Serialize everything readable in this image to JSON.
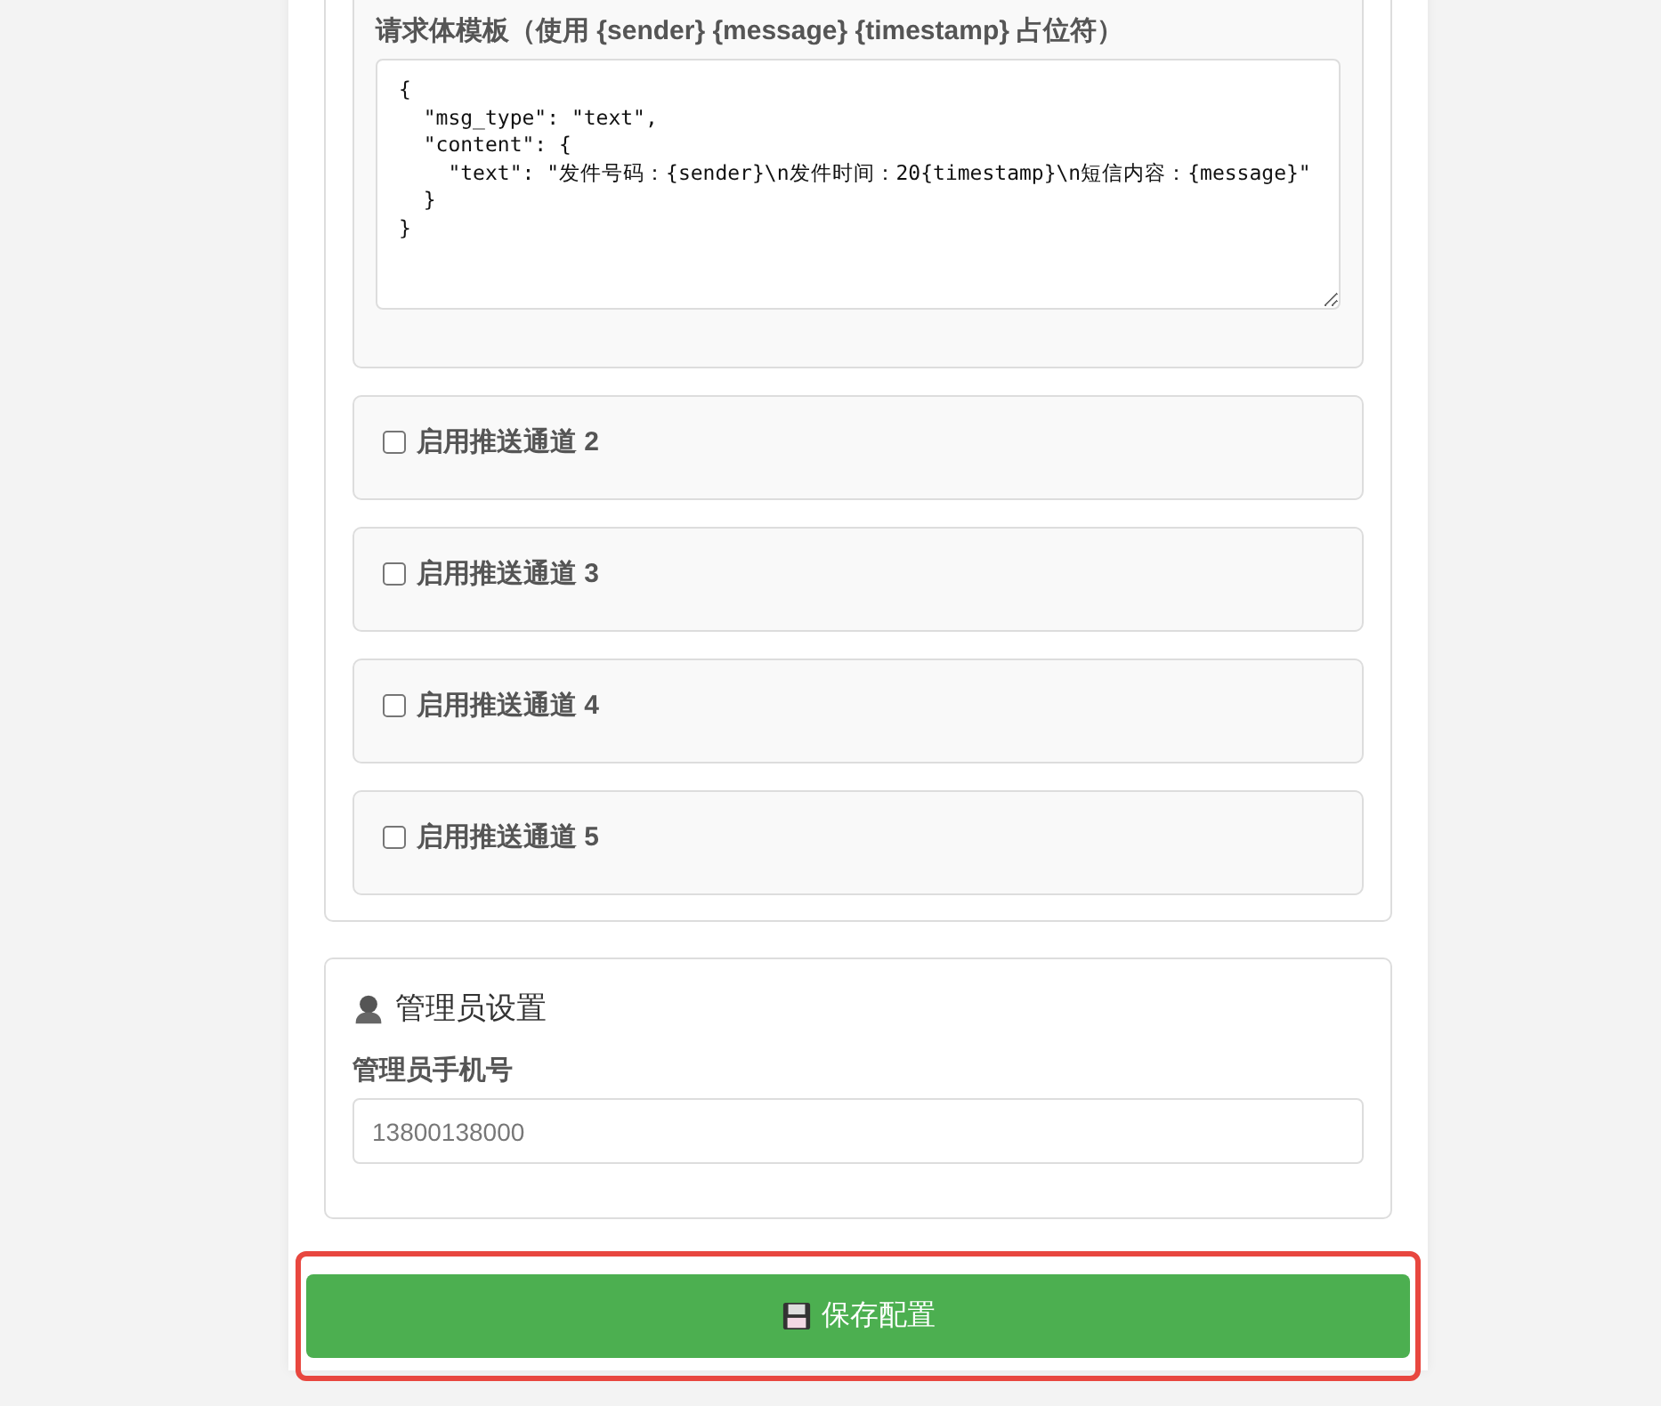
{
  "push_channels": {
    "template": {
      "label": "请求体模板（使用 {sender} {message} {timestamp} 占位符）",
      "value": "{\n  \"msg_type\": \"text\",\n  \"content\": {\n    \"text\": \"发件号码：{sender}\\n发件时间：20{timestamp}\\n短信内容：{message}\"\n  }\n}"
    },
    "channels": [
      {
        "label": "启用推送通道 2",
        "checked": false
      },
      {
        "label": "启用推送通道 3",
        "checked": false
      },
      {
        "label": "启用推送通道 4",
        "checked": false
      },
      {
        "label": "启用推送通道 5",
        "checked": false
      }
    ]
  },
  "admin": {
    "title": "管理员设置",
    "phone_label": "管理员手机号",
    "phone_placeholder": "13800138000"
  },
  "save_button": {
    "label": "保存配置",
    "highlighted": true
  }
}
